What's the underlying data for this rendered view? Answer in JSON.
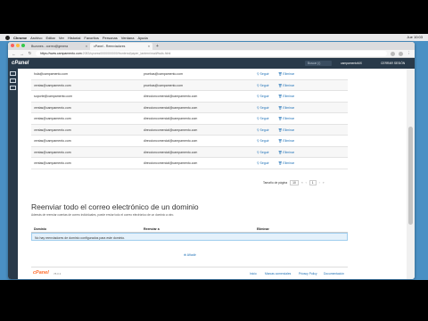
{
  "menubar": {
    "items": [
      "Chrome",
      "Archivo",
      "Editar",
      "Ver",
      "Historial",
      "Favoritos",
      "Personas",
      "Ventana",
      "Ayuda"
    ],
    "clock": "Jue 10:03"
  },
  "browser": {
    "tabs": [
      {
        "label": "Buzones - correo@genera",
        "active": false
      },
      {
        "label": "cPanel - Reenviadores",
        "active": true
      }
    ],
    "url_host": "https://www.campamento.com",
    "url_path": ":2083/cpsess0000000000/frontend/paper_lantern/mail/fwds.html"
  },
  "cpanel": {
    "logo": "cPanel",
    "search_placeholder": "Buscar (/)",
    "user": "campamentoMX",
    "logout": "CERRAR SESIÓN"
  },
  "forwarders": {
    "rows": [
      {
        "address": "hola@campamento.com",
        "destination": "pruebas@campamento.com",
        "action1": "Seguir",
        "action2": "Eliminar"
      },
      {
        "address": "ventas@campamento.com",
        "destination": "pruebas@campamento.com",
        "action1": "Seguir",
        "action2": "Eliminar"
      },
      {
        "address": "soporte@campamento.com",
        "destination": "direccioncomercial@campamento.com",
        "action1": "Seguir",
        "action2": "Eliminar"
      },
      {
        "address": "ventas@campamento.com",
        "destination": "direccioncomercial@campamento.com",
        "action1": "Seguir",
        "action2": "Eliminar"
      },
      {
        "address": "ventas@campamento.com",
        "destination": "direccioncomercial@campamento.com",
        "action1": "Seguir",
        "action2": "Eliminar"
      },
      {
        "address": "ventas@campamento.com",
        "destination": "direccioncomercial@campamento.com",
        "action1": "Seguir",
        "action2": "Eliminar"
      },
      {
        "address": "ventas@campamento.com",
        "destination": "direccioncomercial@campamento.com",
        "action1": "Seguir",
        "action2": "Eliminar"
      },
      {
        "address": "ventas@campamento.com",
        "destination": "direccioncomercial@campamento.com",
        "action1": "Seguir",
        "action2": "Eliminar"
      },
      {
        "address": "ventas@campamento.com",
        "destination": "direccioncomercial@campamento.com",
        "action1": "Seguir",
        "action2": "Eliminar"
      }
    ],
    "pager": {
      "label": "Tamaño de página",
      "size": "10",
      "first": "«",
      "prev": "‹",
      "page": "1",
      "next": "›",
      "last": "»"
    }
  },
  "domain_forward": {
    "title": "Reenviar todo el correo electrónico de un dominio",
    "description": "Además de reenviar cuentas de correo individuales, puede enviar todo el correo electrónico de un dominio a otro.",
    "columns": [
      "Dominio",
      "Reenviar a",
      "Eliminar"
    ],
    "empty_message": "No hay reenviadores de dominio configurados para este dominio.",
    "add_link": "Añadir"
  },
  "footer": {
    "logo": "cPanel",
    "version": "78.0.3",
    "links": [
      "Inicio",
      "Marcas comerciales",
      "Privacy Policy",
      "Documentación"
    ]
  },
  "colors": {
    "cpanel_header": "#293a4a",
    "cpanel_orange": "#ff6c2c",
    "link_blue": "#1c6fb5",
    "desktop_blue": "#4a90c4"
  }
}
